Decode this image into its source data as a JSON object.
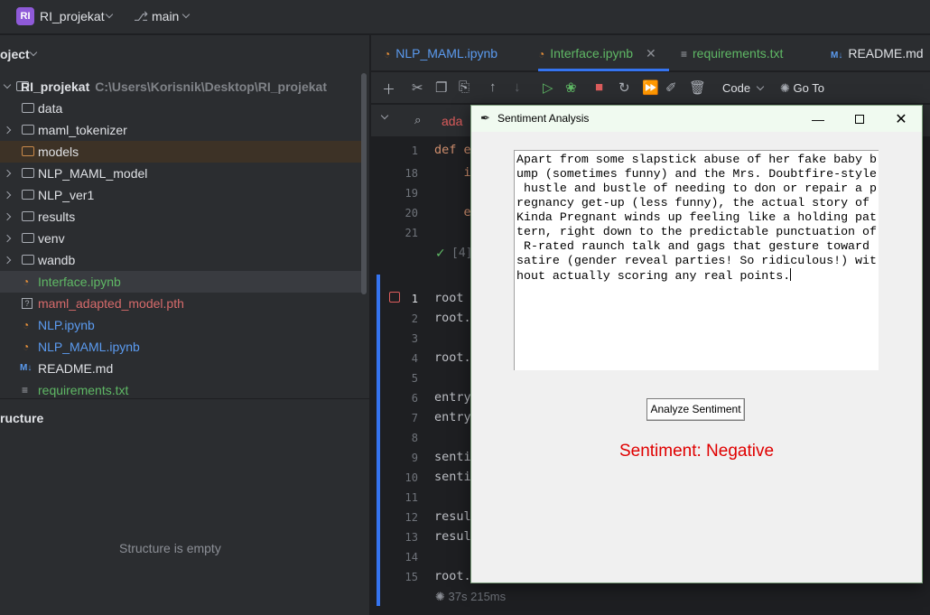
{
  "titlebar": {
    "project_badge": "RI",
    "project_name": "RI_projekat",
    "branch": "main"
  },
  "project_panel": {
    "title": "oject",
    "root": {
      "name": "RI_projekat",
      "path": "C:\\Users\\Korisnik\\Desktop\\RI_projekat"
    },
    "items": [
      {
        "label": "data",
        "kind": "folder"
      },
      {
        "label": "maml_tokenizer",
        "kind": "folder"
      },
      {
        "label": "models",
        "kind": "folder"
      },
      {
        "label": "NLP_MAML_model",
        "kind": "folder"
      },
      {
        "label": "NLP_ver1",
        "kind": "folder"
      },
      {
        "label": "results",
        "kind": "folder"
      },
      {
        "label": "venv",
        "kind": "folder"
      },
      {
        "label": "wandb",
        "kind": "folder"
      },
      {
        "label": "Interface.ipynb",
        "kind": "notebook"
      },
      {
        "label": "maml_adapted_model.pth",
        "kind": "unknown"
      },
      {
        "label": "NLP.ipynb",
        "kind": "notebook"
      },
      {
        "label": "NLP_MAML.ipynb",
        "kind": "notebook"
      },
      {
        "label": "README.md",
        "kind": "markdown"
      },
      {
        "label": "requirements.txt",
        "kind": "text"
      }
    ],
    "structure_title": "ructure",
    "structure_empty": "Structure is empty"
  },
  "tabs": [
    {
      "label": "NLP_MAML.ipynb"
    },
    {
      "label": "Interface.ipynb"
    },
    {
      "label": "requirements.txt"
    },
    {
      "label": "README.md"
    }
  ],
  "toolbar": {
    "code_label": "Code",
    "goto_label": "Go To"
  },
  "searchbar": {
    "query": "ada"
  },
  "editor": {
    "top_lines": [
      {
        "num": "1",
        "code": "def e"
      },
      {
        "num": "18",
        "code": "    i"
      },
      {
        "num": "19",
        "code": ""
      },
      {
        "num": "20",
        "code": "    e"
      },
      {
        "num": "21",
        "code": ""
      }
    ],
    "ok_text": "[4]",
    "lines": [
      {
        "num": "1",
        "code": "root"
      },
      {
        "num": "2",
        "code": "root."
      },
      {
        "num": "3",
        "code": ""
      },
      {
        "num": "4",
        "code": "root."
      },
      {
        "num": "5",
        "code": ""
      },
      {
        "num": "6",
        "code": "entry"
      },
      {
        "num": "7",
        "code": "entry"
      },
      {
        "num": "8",
        "code": ""
      },
      {
        "num": "9",
        "code": "senti"
      },
      {
        "num": "10",
        "code": "senti"
      },
      {
        "num": "11",
        "code": ""
      },
      {
        "num": "12",
        "code": "resul"
      },
      {
        "num": "13",
        "code": "resul"
      },
      {
        "num": "14",
        "code": ""
      },
      {
        "num": "15",
        "code": "root."
      }
    ],
    "exec_status": "37s 215ms"
  },
  "dialog": {
    "title": "Sentiment Analysis",
    "text_lines": [
      "Apart from some slapstick abuse of her fake baby b",
      "ump (sometimes funny) and the Mrs. Doubtfire-style",
      " hustle and bustle of needing to don or repair a p",
      "regnancy get-up (less funny), the actual story of",
      "Kinda Pregnant winds up feeling like a holding pat",
      "tern, right down to the predictable punctuation of",
      " R-rated raunch talk and gags that gesture toward",
      "satire (gender reveal parties! So ridiculous!) wit",
      "hout actually scoring any real points."
    ],
    "button_label": "Analyze Sentiment",
    "result_text": "Sentiment: Negative",
    "result_color": "#e00000"
  }
}
